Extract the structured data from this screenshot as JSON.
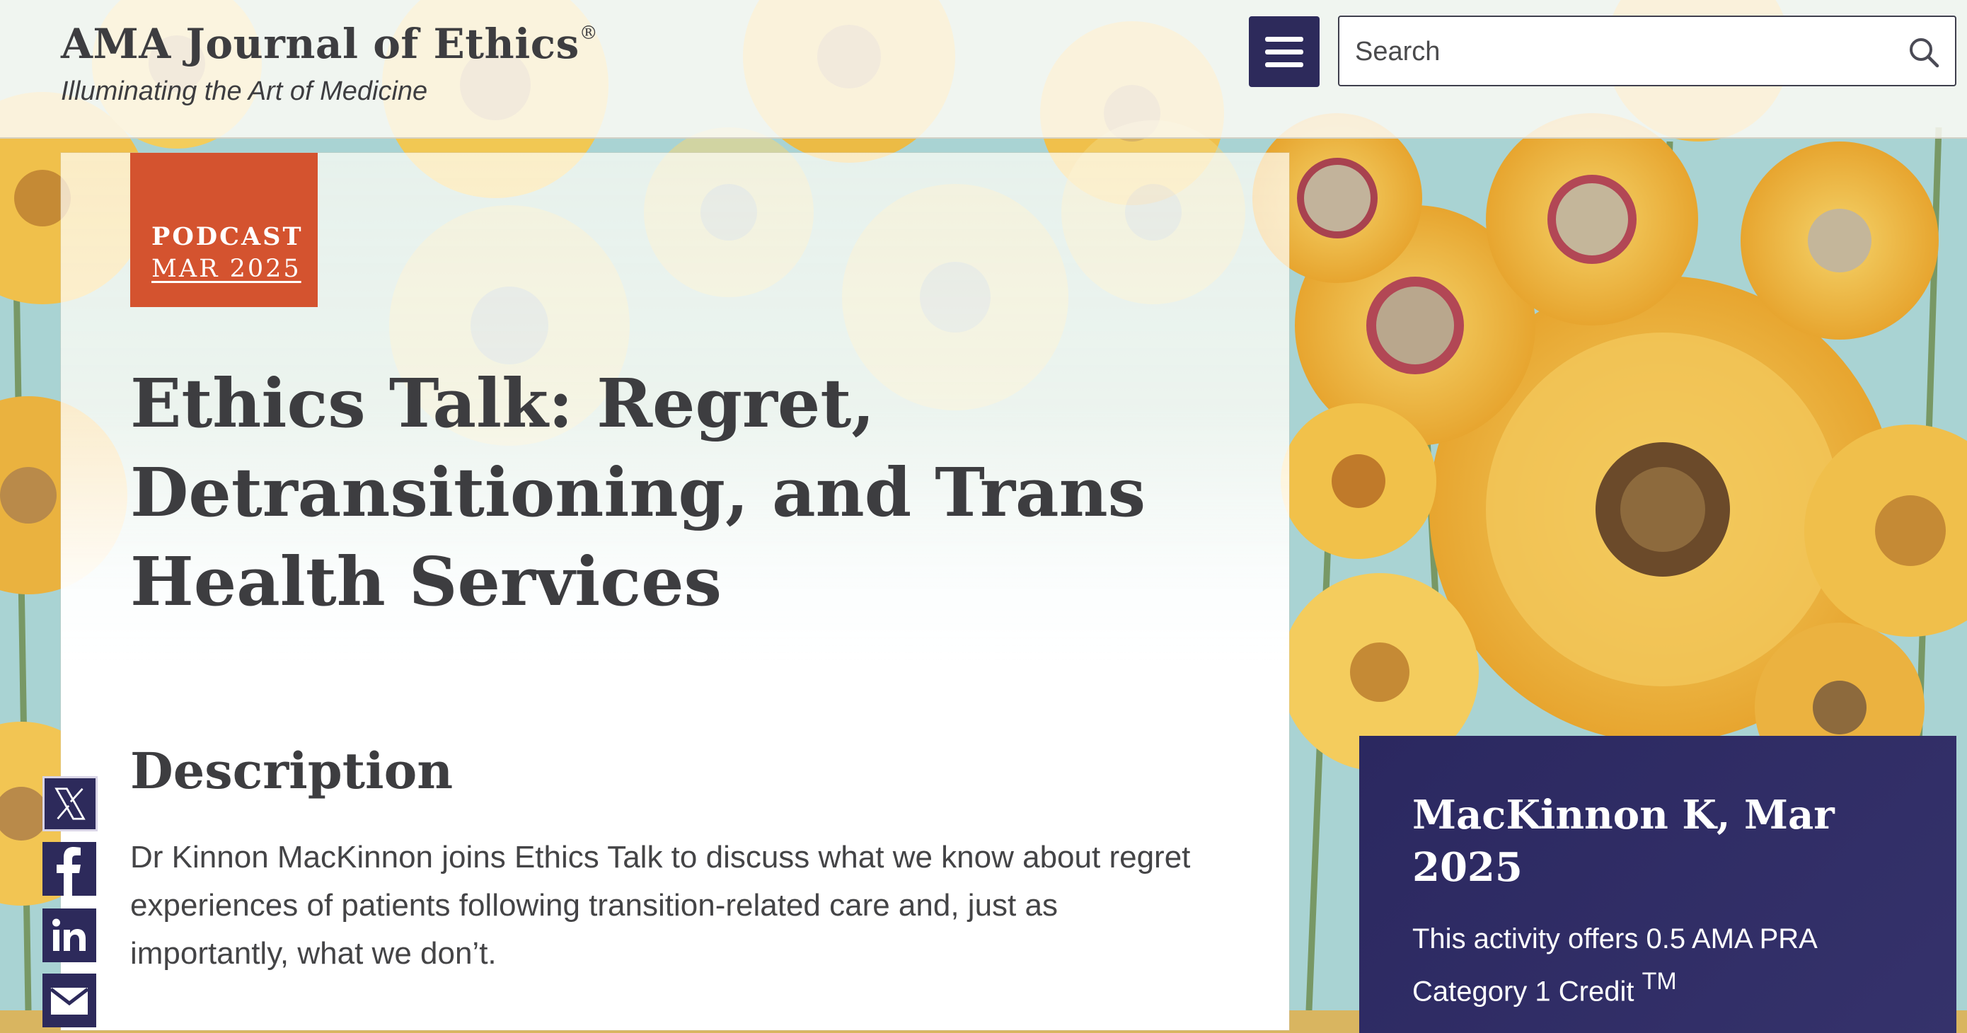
{
  "header": {
    "site_title": "AMA Journal of Ethics",
    "registered_mark": "®",
    "tagline": "Illuminating the Art of Medicine",
    "menu_icon": "hamburger-menu-icon",
    "search": {
      "placeholder": "Search",
      "value": "",
      "icon": "search-icon"
    }
  },
  "article": {
    "badge": {
      "type": "PODCAST",
      "date": "MAR 2025"
    },
    "title": "Ethics Talk: Regret, Detransitioning, and Trans Health Services",
    "description_heading": "Description",
    "description": "Dr Kinnon MacKinnon joins Ethics Talk to discuss what we know about regret experiences of patients following transition-related care and, just as importantly, what we don’t."
  },
  "share": [
    {
      "icon": "x-twitter-icon"
    },
    {
      "icon": "facebook-icon"
    },
    {
      "icon": "linkedin-icon"
    },
    {
      "icon": "email-icon"
    }
  ],
  "cme": {
    "citation": "MacKinnon K, Mar 2025",
    "credit_text": "This activity offers 0.5 AMA PRA Category 1 Credit",
    "trademark": "TM"
  },
  "colors": {
    "brand_navy": "#2d2a5b",
    "badge_orange": "#d4532f",
    "text_dark": "#3d3d40",
    "sky": "#9fcfd6",
    "sunflower": "#e9b23c"
  }
}
